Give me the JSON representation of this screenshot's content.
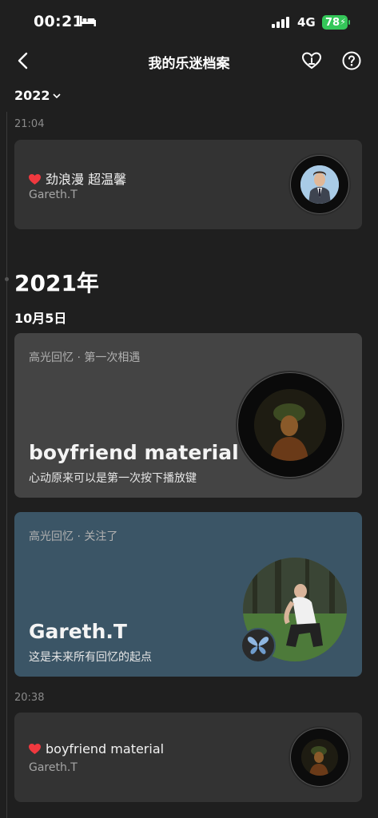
{
  "status_bar": {
    "time": "00:21",
    "network": "4G",
    "battery": "78"
  },
  "header": {
    "title": "我的乐迷档案"
  },
  "year_selector": {
    "label": "2022"
  },
  "entries_2022": {
    "timestamp": "21:04",
    "song": "劲浪漫 超温馨",
    "artist": "Gareth.T"
  },
  "year_heading": "2021年",
  "date_heading": "10月5日",
  "highlight_1": {
    "label": "高光回忆 · 第一次相遇",
    "title": "boyfriend material",
    "subtitle": "心动原来可以是第一次按下播放键"
  },
  "highlight_2": {
    "label": "高光回忆 · 关注了",
    "title": "Gareth.T",
    "subtitle": "这是未来所有回忆的起点"
  },
  "entries_2021": {
    "timestamp": "20:38",
    "song": "boyfriend material",
    "artist": "Gareth.T"
  },
  "colors": {
    "background": "#1f1f1f",
    "card": "#333333",
    "highlight_blue": "#3b5566",
    "heart": "#f0393f",
    "battery": "#34c759"
  }
}
